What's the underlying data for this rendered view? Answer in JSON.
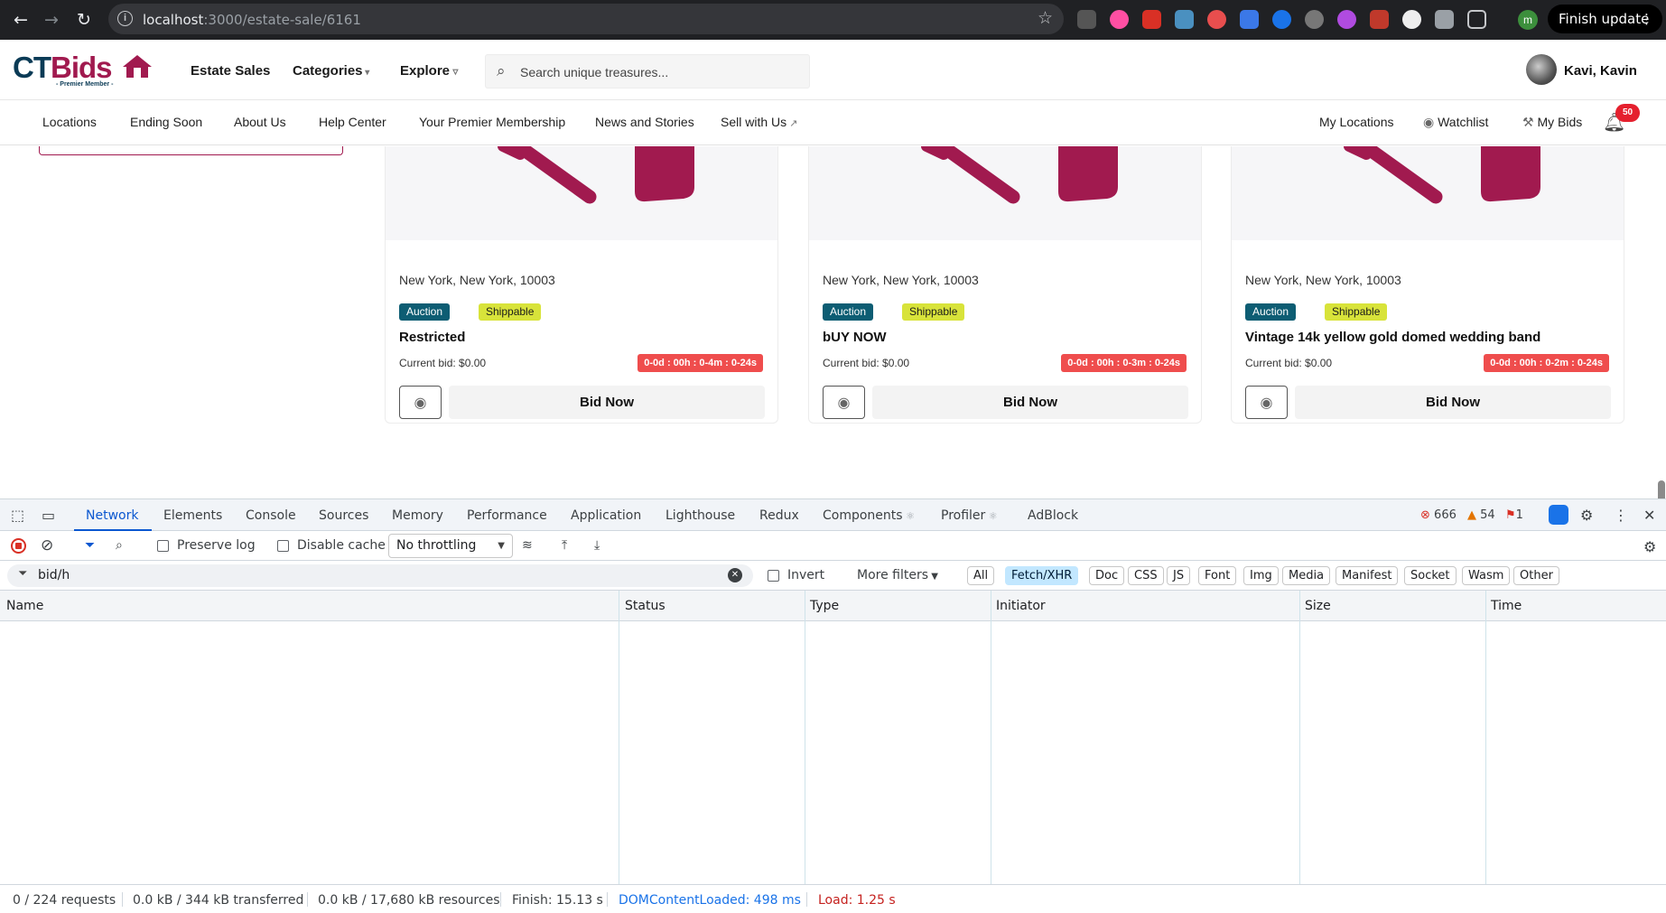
{
  "browser": {
    "url_host": "localhost",
    "url_path": ":3000/estate-sale/6161",
    "finish_update_label": "Finish update",
    "profile_initial": "m"
  },
  "header": {
    "logo_text_ct": "CT",
    "logo_text_bids": "Bids",
    "logo_tagline": "- Premier Member -",
    "nav": [
      "Estate Sales",
      "Categories",
      "Explore"
    ],
    "search_placeholder": "Search unique treasures...",
    "user_name": "Kavi, Kavin"
  },
  "subnav": {
    "left": [
      "Locations",
      "Ending Soon",
      "About Us",
      "Help Center",
      "Your Premier Membership",
      "News and Stories",
      "Sell with Us"
    ],
    "right": [
      "My Locations",
      "Watchlist",
      "My Bids"
    ],
    "notification_count": "50"
  },
  "cards": [
    {
      "location": "New York, New York, 10003",
      "tag_auction": "Auction",
      "tag_shippable": "Shippable",
      "title": "Restricted",
      "current_bid": "Current bid: $0.00",
      "timer": "0-0d : 00h : 0-4m : 0-24s",
      "bid_label": "Bid Now"
    },
    {
      "location": "New York, New York, 10003",
      "tag_auction": "Auction",
      "tag_shippable": "Shippable",
      "title": "bUY NOW",
      "current_bid": "Current bid: $0.00",
      "timer": "0-0d : 00h : 0-3m : 0-24s",
      "bid_label": "Bid Now"
    },
    {
      "location": "New York, New York, 10003",
      "tag_auction": "Auction",
      "tag_shippable": "Shippable",
      "title": "Vintage 14k yellow gold domed wedding band",
      "current_bid": "Current bid: $0.00",
      "timer": "0-0d : 00h : 0-2m : 0-24s",
      "bid_label": "Bid Now"
    }
  ],
  "devtools": {
    "tabs": [
      "Network",
      "Elements",
      "Console",
      "Sources",
      "Memory",
      "Performance",
      "Application",
      "Lighthouse",
      "Redux",
      "Components",
      "Profiler",
      "AdBlock"
    ],
    "errors": "666",
    "warnings": "54",
    "issues": "1",
    "preserve_log": "Preserve log",
    "disable_cache": "Disable cache",
    "throttling": "No throttling",
    "filter_value": "bid/h",
    "invert": "Invert",
    "more_filters": "More filters",
    "type_filters": [
      "All",
      "Fetch/XHR",
      "Doc",
      "CSS",
      "JS",
      "Font",
      "Img",
      "Media",
      "Manifest",
      "Socket",
      "Wasm",
      "Other"
    ],
    "columns": [
      "Name",
      "Status",
      "Type",
      "Initiator",
      "Size",
      "Time"
    ],
    "status": {
      "requests": "0 / 224 requests",
      "transferred": "0.0 kB / 344 kB transferred",
      "resources": "0.0 kB / 17,680 kB resources",
      "finish": "Finish: 15.13 s",
      "dom_loaded": "DOMContentLoaded: 498 ms",
      "load": "Load: 1.25 s"
    }
  },
  "colors": {
    "brand_navy": "#0b3b56",
    "brand_magenta": "#a11a4f",
    "auction_tag": "#0d5d73",
    "shippable_tag": "#d8e33a",
    "timer_red": "#ef4d4d",
    "devtools_blue": "#0b57d0"
  }
}
